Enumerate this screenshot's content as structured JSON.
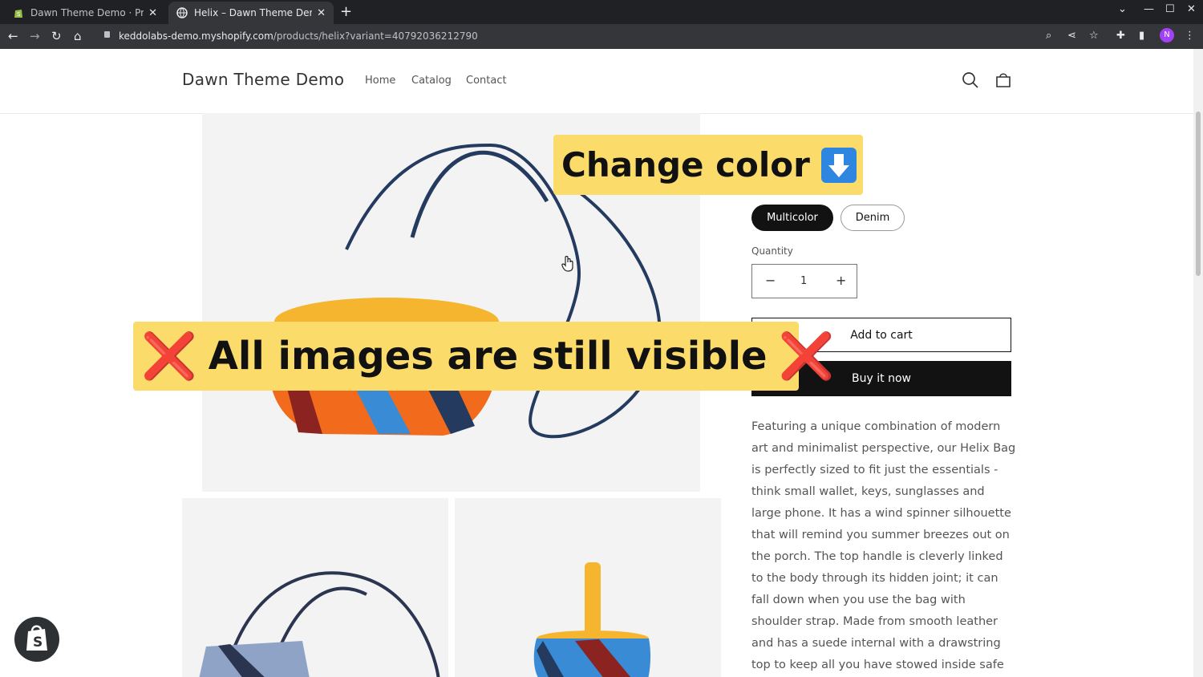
{
  "browser": {
    "tabs": [
      {
        "title": "Dawn Theme Demo · Product",
        "close": "✕"
      },
      {
        "title": "Helix – Dawn Theme Demo",
        "close": "✕"
      }
    ],
    "new_tab": "+",
    "url_host": "keddolabs-demo.myshopify.com",
    "url_path": "/products/helix?variant=40792036212790",
    "profile_initial": "N"
  },
  "store": {
    "name": "Dawn Theme Demo",
    "nav": [
      "Home",
      "Catalog",
      "Contact"
    ]
  },
  "product": {
    "variants": [
      {
        "label": "Multicolor",
        "selected": true
      },
      {
        "label": "Denim",
        "selected": false
      }
    ],
    "quantity_label": "Quantity",
    "quantity": "1",
    "qty_minus": "−",
    "qty_plus": "+",
    "add_to_cart": "Add to cart",
    "buy_now": "Buy it now",
    "description": "Featuring a unique combination of modern art and minimalist perspective, our Helix Bag is perfectly sized to fit just the essentials - think small wallet, keys, sunglasses and large phone. It has a wind spinner silhouette that will remind you summer breezes out on the porch. The top handle is cleverly linked to the body through its hidden joint; it can fall down when you use the bag with shoulder strap. Made from smooth leather and has a suede internal with a drawstring top to keep all you have stowed inside safe and secure."
  },
  "overlays": {
    "top_text": "Change color",
    "mid_text": "All images are still visible",
    "mark": "❌"
  },
  "colors": {
    "banner": "#fbdc6a",
    "accent_blue": "#2f86e0",
    "bag_orange": "#f26a1b",
    "bag_blue": "#3a8bd6",
    "bag_navy": "#243a5e"
  }
}
